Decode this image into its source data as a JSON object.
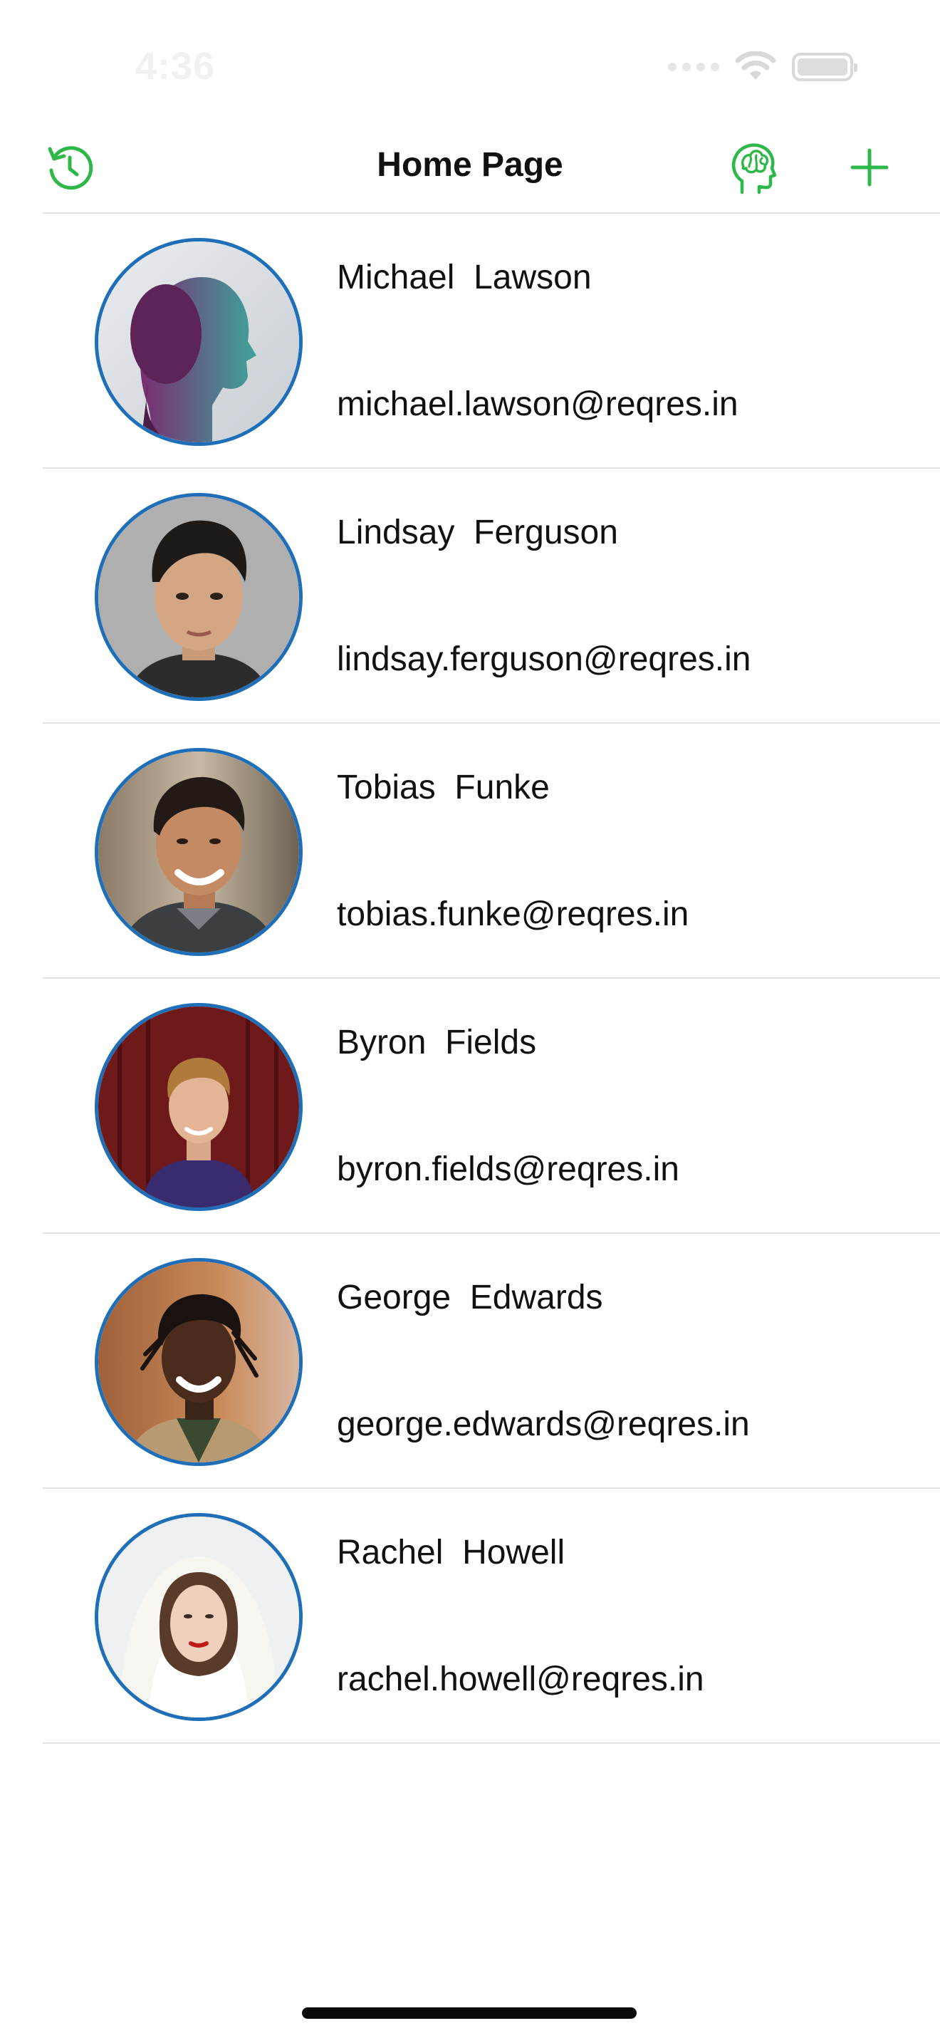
{
  "status_bar": {
    "time": "4:36"
  },
  "nav": {
    "title": "Home Page",
    "refresh_icon": "refresh-icon",
    "brain_icon": "brain-head-icon",
    "add_icon": "plus-icon",
    "accent_color": "#2fb84a"
  },
  "users": [
    {
      "first_name": "Michael",
      "last_name": "Lawson",
      "name": "Michael  Lawson",
      "email": "michael.lawson@reqres.in"
    },
    {
      "first_name": "Lindsay",
      "last_name": "Ferguson",
      "name": "Lindsay  Ferguson",
      "email": "lindsay.ferguson@reqres.in"
    },
    {
      "first_name": "Tobias",
      "last_name": "Funke",
      "name": "Tobias  Funke",
      "email": "tobias.funke@reqres.in"
    },
    {
      "first_name": "Byron",
      "last_name": "Fields",
      "name": "Byron  Fields",
      "email": "byron.fields@reqres.in"
    },
    {
      "first_name": "George",
      "last_name": "Edwards",
      "name": "George  Edwards",
      "email": "george.edwards@reqres.in"
    },
    {
      "first_name": "Rachel",
      "last_name": "Howell",
      "name": "Rachel  Howell",
      "email": "rachel.howell@reqres.in"
    }
  ],
  "colors": {
    "avatar_border": "#1f6fb8",
    "divider": "#e4e4e4",
    "accent": "#2fb84a"
  }
}
